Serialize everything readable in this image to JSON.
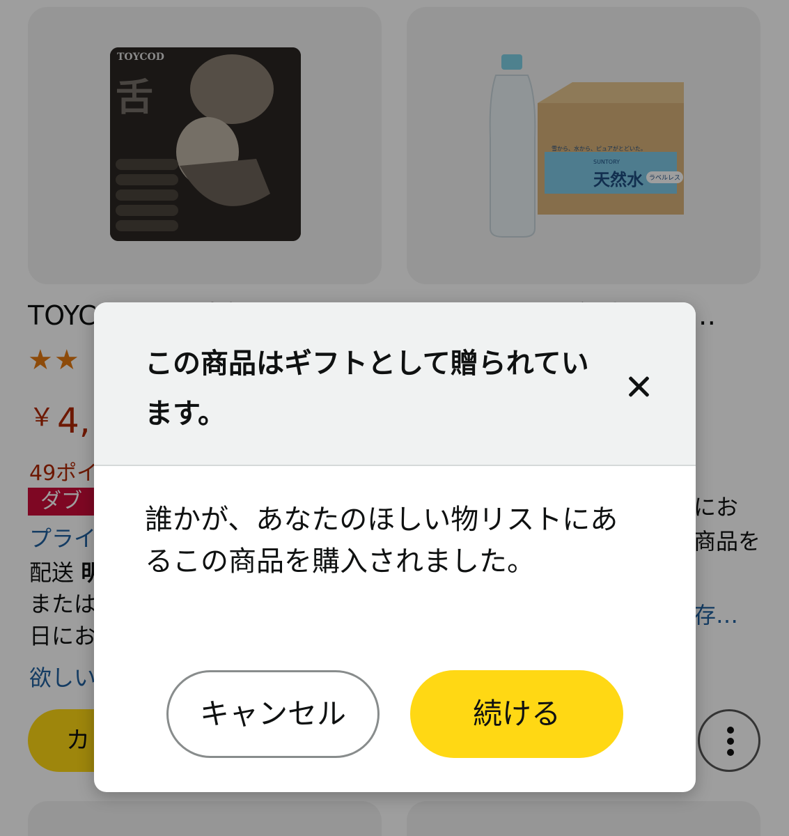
{
  "colors": {
    "accent_yellow": "#ffd814",
    "price_red": "#b12704",
    "badge_red": "#cc0c39",
    "link_blue": "#2162a1",
    "star_orange": "#e47911"
  },
  "products": [
    {
      "image_brand_text": "TOYCOD",
      "title": "TOYCOD 【舌責姫】吸",
      "stars_glyphs": "★★",
      "price_symbol": "￥",
      "price": "4,",
      "points": "49ポイ",
      "badge": "ダブル",
      "prime_link": "プライ",
      "delivery_label": "配送",
      "delivery_value": "明",
      "or_label": "または",
      "date_fragment": "日にお",
      "wishlist_link": "欲しい",
      "cart_button": "カ"
    },
    {
      "image_box_text": "雪から、水から、ピュアがとどいた。",
      "image_brand": "SUNTORY",
      "image_product": "天然水",
      "image_label_badge": "ラベルレス",
      "title": "サントリー 天然水 ラベ…",
      "text_line_1": "にお",
      "text_line_2": "商品を",
      "link_fragment": "存…",
      "more_icon": "more-vertical-icon"
    }
  ],
  "dialog": {
    "title": "この商品はギフトとして贈られています。",
    "close_icon": "close-icon",
    "body": "誰かが、あなたのほしい物リストにあるこの商品を購入されました。",
    "cancel_label": "キャンセル",
    "continue_label": "続ける"
  }
}
